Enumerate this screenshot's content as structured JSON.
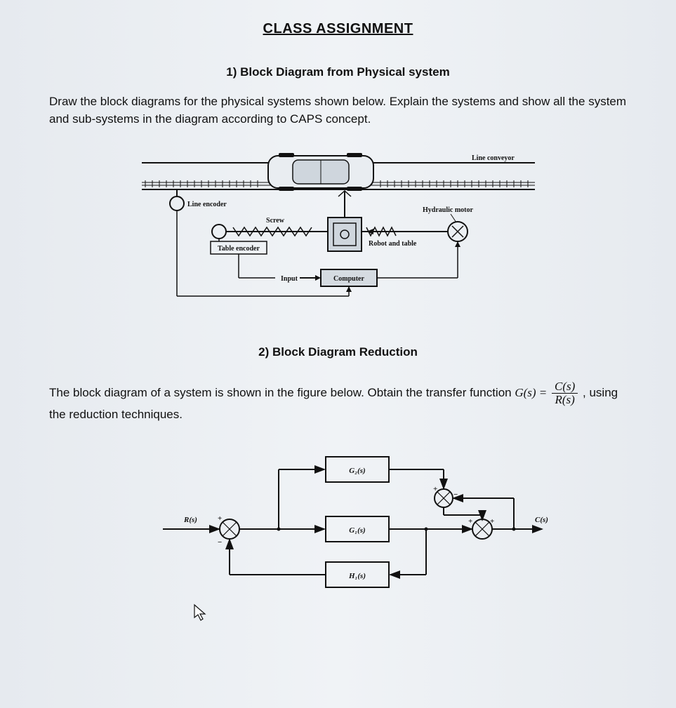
{
  "title": "CLASS ASSIGNMENT",
  "q1": {
    "heading": "1)  Block Diagram from Physical system",
    "prompt": "Draw the block diagrams for the physical systems shown below. Explain the systems and show all the system and sub-systems in the diagram according to CAPS concept.",
    "labels": {
      "line_conveyor": "Line conveyor",
      "line_encoder": "Line encoder",
      "screw": "Screw",
      "hydraulic_motor": "Hydraulic motor",
      "table_encoder": "Table encoder",
      "robot_and_table": "Robot and table",
      "input": "Input",
      "computer": "Computer"
    }
  },
  "q2": {
    "heading": "2) Block Diagram Reduction",
    "prompt_pre": "The block diagram of a system is shown in the figure below. Obtain the transfer function ",
    "tf_lhs": "G(s) =",
    "tf_num": "C(s)",
    "tf_den": "R(s)",
    "prompt_post": " , using the reduction techniques.",
    "labels": {
      "R": "R(s)",
      "C": "C(s)",
      "G1": "G₁(s)",
      "G2": "G₂(s)",
      "H1": "H₁(s)"
    }
  }
}
